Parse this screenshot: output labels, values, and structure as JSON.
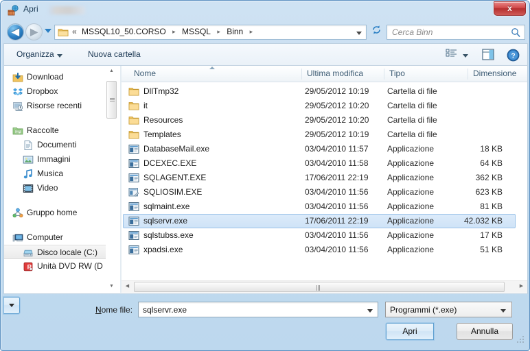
{
  "window": {
    "title": "Apri",
    "title_redacted": true,
    "close_label": "x",
    "icon": "open-folder-globe-icon"
  },
  "navbar": {
    "back_glyph": "◀",
    "forward_glyph": "▶",
    "breadcrumb_lead": "«",
    "crumbs": [
      "MSSQL10_50.CORSO",
      "MSSQL",
      "Binn"
    ],
    "crumb_separator": "▸",
    "refresh_glyph": "↻",
    "search_placeholder": "Cerca Binn"
  },
  "commandbar": {
    "organize_label": "Organizza",
    "new_folder_label": "Nuova cartella",
    "view_icon": "view-list-icon",
    "preview_pane_icon": "preview-pane-icon",
    "help_icon": "help-icon"
  },
  "nav_pane": {
    "items": [
      {
        "label": "Download",
        "icon": "download-icon",
        "level": 0,
        "selected": false
      },
      {
        "label": "Dropbox",
        "icon": "dropbox-icon",
        "level": 0,
        "selected": false
      },
      {
        "label": "Risorse recenti",
        "icon": "recent-icon",
        "level": 0,
        "selected": false
      },
      {
        "label": "Raccolte",
        "icon": "libraries-icon",
        "level": 0,
        "selected": false
      },
      {
        "label": "Documenti",
        "icon": "documents-icon",
        "level": 1,
        "selected": false
      },
      {
        "label": "Immagini",
        "icon": "pictures-icon",
        "level": 1,
        "selected": false
      },
      {
        "label": "Musica",
        "icon": "music-icon",
        "level": 1,
        "selected": false
      },
      {
        "label": "Video",
        "icon": "video-icon",
        "level": 1,
        "selected": false
      },
      {
        "label": "Gruppo home",
        "icon": "homegroup-icon",
        "level": 0,
        "selected": false
      },
      {
        "label": "Computer",
        "icon": "computer-icon",
        "level": 0,
        "selected": false
      },
      {
        "label": "Disco locale (C:)",
        "icon": "harddisk-icon",
        "level": 1,
        "selected": true
      },
      {
        "label": "Unità DVD RW (D",
        "icon": "dvd-drive-icon",
        "level": 1,
        "selected": false
      }
    ],
    "scroll_up_glyph": "▲",
    "scroll_down_glyph": "▼"
  },
  "file_list": {
    "columns": [
      "Nome",
      "Ultima modifica",
      "Tipo",
      "Dimensione"
    ],
    "sorted_by": "Nome",
    "rows": [
      {
        "name": "DllTmp32",
        "icon": "folder-icon",
        "date": "29/05/2012 10:19",
        "type": "Cartella di file",
        "size": "",
        "selected": false
      },
      {
        "name": "it",
        "icon": "folder-icon",
        "date": "29/05/2012 10:20",
        "type": "Cartella di file",
        "size": "",
        "selected": false
      },
      {
        "name": "Resources",
        "icon": "folder-icon",
        "date": "29/05/2012 10:20",
        "type": "Cartella di file",
        "size": "",
        "selected": false
      },
      {
        "name": "Templates",
        "icon": "folder-icon",
        "date": "29/05/2012 10:19",
        "type": "Cartella di file",
        "size": "",
        "selected": false
      },
      {
        "name": "DatabaseMail.exe",
        "icon": "application-icon",
        "date": "03/04/2010 11:57",
        "type": "Applicazione",
        "size": "18 KB",
        "selected": false
      },
      {
        "name": "DCEXEC.EXE",
        "icon": "application-icon",
        "date": "03/04/2010 11:58",
        "type": "Applicazione",
        "size": "64 KB",
        "selected": false
      },
      {
        "name": "SQLAGENT.EXE",
        "icon": "application-icon",
        "date": "17/06/2011 22:19",
        "type": "Applicazione",
        "size": "362 KB",
        "selected": false
      },
      {
        "name": "SQLIOSIM.EXE",
        "icon": "application-alt-icon",
        "date": "03/04/2010 11:56",
        "type": "Applicazione",
        "size": "623 KB",
        "selected": false
      },
      {
        "name": "sqlmaint.exe",
        "icon": "application-icon",
        "date": "03/04/2010 11:56",
        "type": "Applicazione",
        "size": "81 KB",
        "selected": false
      },
      {
        "name": "sqlservr.exe",
        "icon": "application-icon",
        "date": "17/06/2011 22:19",
        "type": "Applicazione",
        "size": "42.032 KB",
        "selected": true
      },
      {
        "name": "sqlstubss.exe",
        "icon": "application-icon",
        "date": "03/04/2010 11:56",
        "type": "Applicazione",
        "size": "17 KB",
        "selected": false
      },
      {
        "name": "xpadsi.exe",
        "icon": "application-icon",
        "date": "03/04/2010 11:56",
        "type": "Applicazione",
        "size": "51 KB",
        "selected": false
      }
    ],
    "hscroll_left_glyph": "◀",
    "hscroll_right_glyph": "▶"
  },
  "bottom": {
    "filename_label_prefix": "N",
    "filename_label_rest": "ome file:",
    "filename_value": "sqlservr.exe",
    "filetype_value": "Programmi (*.exe)",
    "open_label": "Apri",
    "cancel_label": "Annulla"
  },
  "colors": {
    "accent": "#2a7fc4",
    "selection": "#cfe3f7",
    "selection_border": "#9ac2e8",
    "close_red": "#b52f2f",
    "frame_blue": "#bdd8ee",
    "header_text": "#3b5a72"
  }
}
